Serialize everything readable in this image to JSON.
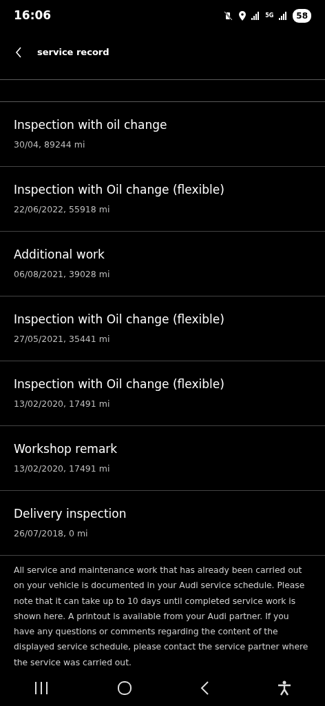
{
  "status_bar": {
    "time": "16:06",
    "network": "5G",
    "battery": "58"
  },
  "header": {
    "title": "service record"
  },
  "records": [
    {
      "title": "Inspection with oil change",
      "detail": "30/04, 89244 mi"
    },
    {
      "title": "Inspection with Oil change (flexible)",
      "detail": "22/06/2022, 55918 mi"
    },
    {
      "title": "Additional work",
      "detail": "06/08/2021, 39028 mi"
    },
    {
      "title": "Inspection with Oil change (flexible)",
      "detail": "27/05/2021, 35441 mi"
    },
    {
      "title": "Inspection with Oil change (flexible)",
      "detail": "13/02/2020, 17491 mi"
    },
    {
      "title": "Workshop remark",
      "detail": "13/02/2020, 17491 mi"
    },
    {
      "title": "Delivery inspection",
      "detail": "26/07/2018, 0 mi"
    }
  ],
  "note": "All service and maintenance work that has already been carried out on your vehicle is documented in your Audi service schedule. Please note that it can take up to 10 days until completed service work is shown here. A printout is available from your Audi partner. If you have any questions or comments regarding the content of the displayed service schedule, please contact the service partner where the service was carried out."
}
